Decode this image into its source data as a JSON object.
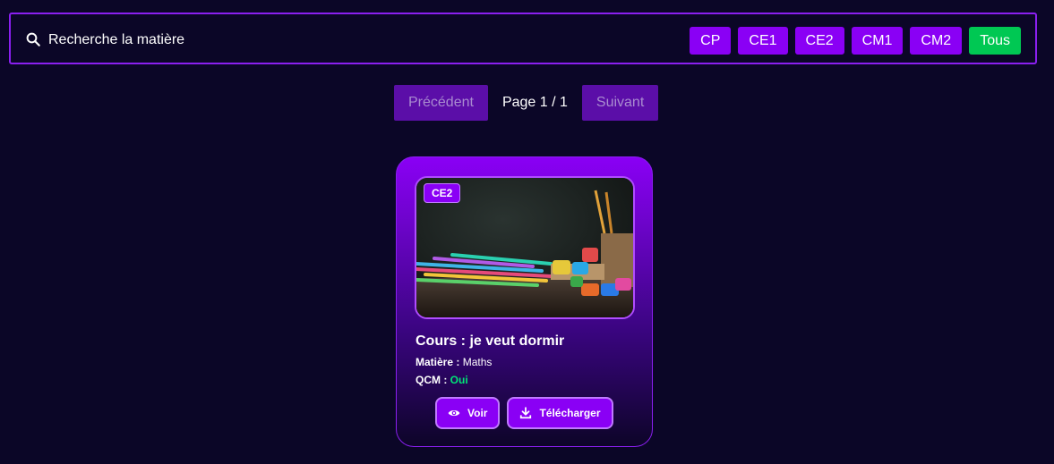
{
  "search": {
    "placeholder": "Recherche la matière"
  },
  "filters": [
    {
      "label": "CP",
      "active": false
    },
    {
      "label": "CE1",
      "active": false
    },
    {
      "label": "CE2",
      "active": false
    },
    {
      "label": "CM1",
      "active": false
    },
    {
      "label": "CM2",
      "active": false
    },
    {
      "label": "Tous",
      "active": true
    }
  ],
  "pagination": {
    "prev_label": "Précédent",
    "indicator": "Page 1 / 1",
    "next_label": "Suivant"
  },
  "card": {
    "level": "CE2",
    "title": "Cours : je veut dormir",
    "subject_label": "Matière :",
    "subject_value": "Maths",
    "qcm_label": "QCM :",
    "qcm_value": "Oui",
    "view_label": "Voir",
    "download_label": "Télécharger",
    "image_icon": "classroom-pencils-image"
  },
  "colors": {
    "accent": "#8a00f5",
    "active_filter": "#00c853",
    "background": "#0b0627",
    "qcm_yes": "#00e676"
  }
}
